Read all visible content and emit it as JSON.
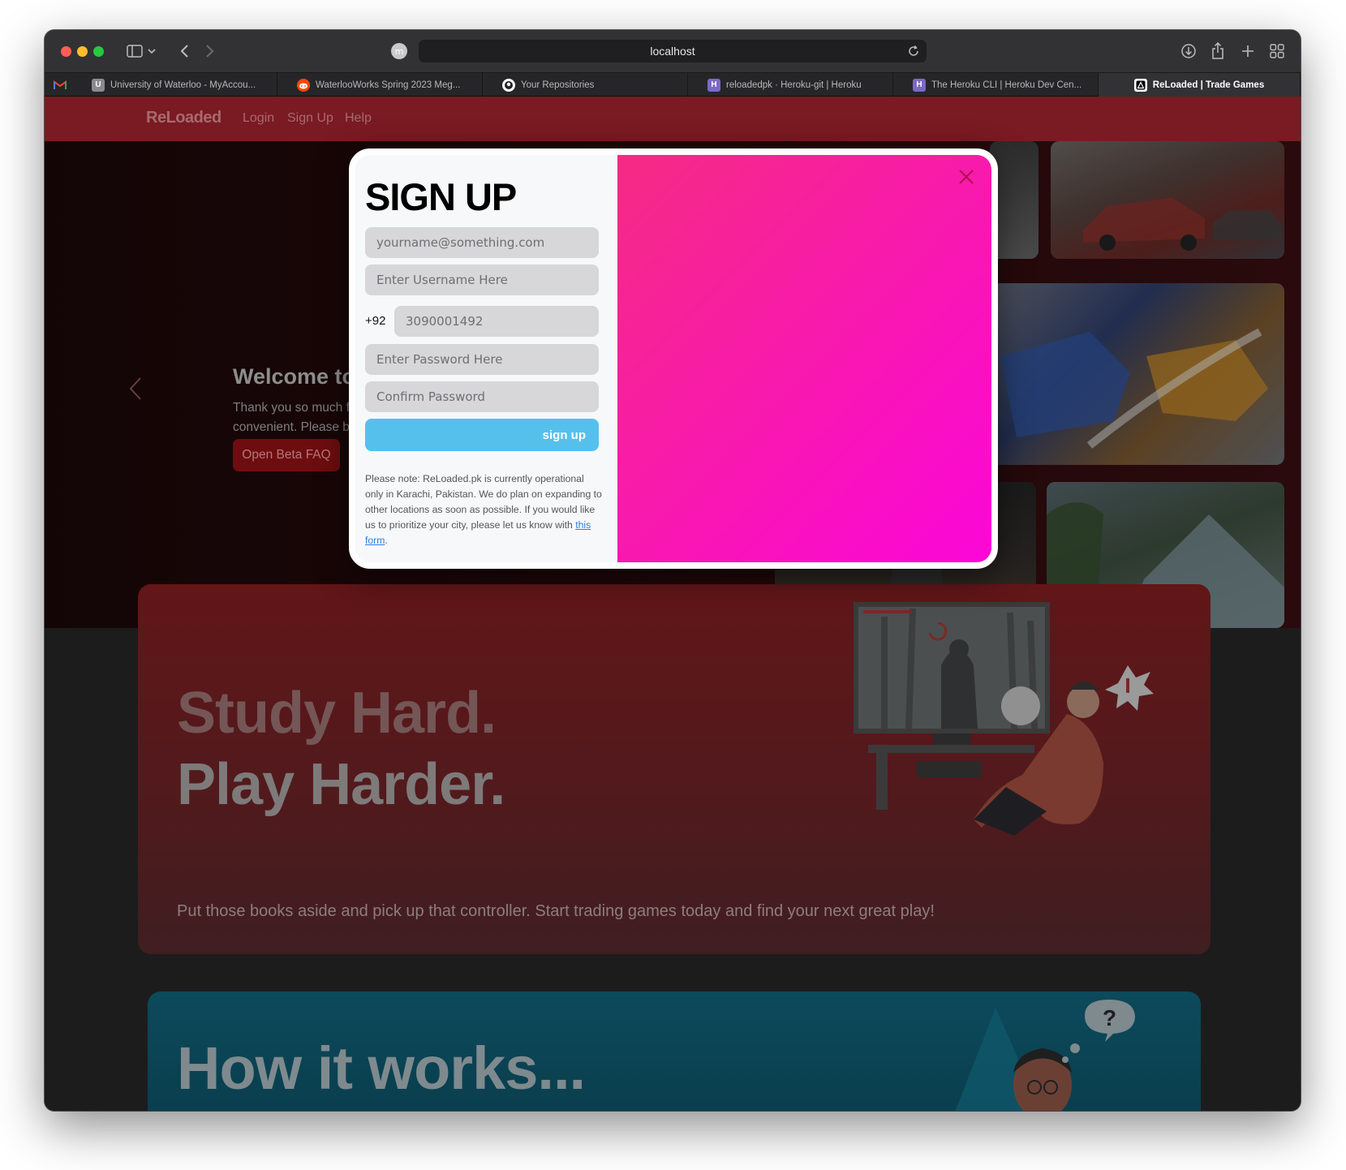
{
  "browser": {
    "url": "localhost",
    "site_avatar_letter": "m",
    "tabs": [
      {
        "label": "University of Waterloo - MyAccou...",
        "favicon": "u-square-icon",
        "fav_letter": "U",
        "fav_color": "#8a8a8e"
      },
      {
        "label": "WaterlooWorks Spring 2023 Meg...",
        "favicon": "reddit-icon",
        "fav_letter": "",
        "fav_color": "#ff4500"
      },
      {
        "label": "Your Repositories",
        "favicon": "github-icon",
        "fav_letter": "",
        "fav_color": "#ffffff"
      },
      {
        "label": "reloadedpk · Heroku-git | Heroku",
        "favicon": "heroku-icon",
        "fav_letter": "H",
        "fav_color": "#7b68c8"
      },
      {
        "label": "The Heroku CLI | Heroku Dev Cen...",
        "favicon": "heroku-icon",
        "fav_letter": "H",
        "fav_color": "#7b68c8"
      },
      {
        "label": "ReLoaded | Trade Games",
        "favicon": "reloaded-icon",
        "fav_letter": "",
        "fav_color": "#ffffff"
      }
    ]
  },
  "site": {
    "brand": "ReLoaded",
    "nav": {
      "login": "Login",
      "signup": "Sign Up",
      "help": "Help"
    },
    "hero": {
      "title": "Welcome to",
      "text_line1": "Thank you so much f",
      "text_line2": "convenient. Please b",
      "faq_button": "Open Beta FAQ"
    },
    "study": {
      "line1": "Study Hard.",
      "line2": "Play Harder.",
      "description": "Put those books aside and pick up that controller. Start trading games today and find your next great play!"
    },
    "how": {
      "title": "How it works..."
    }
  },
  "modal": {
    "title": "SIGN UP",
    "email_placeholder": "yourname@something.com",
    "username_placeholder": "Enter Username Here",
    "country_code": "+92",
    "phone_placeholder": "3090001492",
    "password_placeholder": "Enter Password Here",
    "confirm_placeholder": "Confirm Password",
    "submit_label": "sign up",
    "note_text": "Please note: ReLoaded.pk is currently operational only in Karachi, Pakistan. We do plan on expanding to other locations as soon as possible. If you would like us to prioritize your city, please let us know with ",
    "note_link": "this form",
    "note_end": ".",
    "gradient_start": "#f52b83",
    "gradient_end": "#fb06d9",
    "button_color": "#56c0ed"
  }
}
